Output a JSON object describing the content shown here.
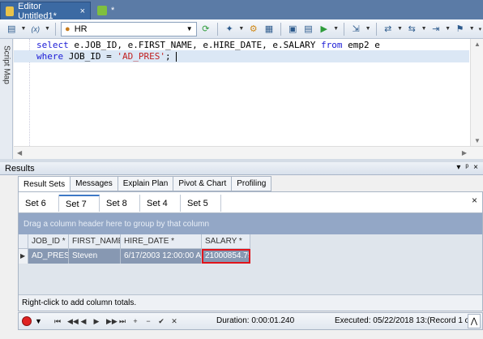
{
  "tabs": [
    {
      "label": "Editor Untitled1*",
      "close": "×"
    },
    {
      "label": "*"
    }
  ],
  "toolbar": {
    "connection": "HR"
  },
  "script_map": {
    "label": "Script Map"
  },
  "editor": {
    "line1": {
      "k1": "select",
      "t1": " e.JOB_ID, e.FIRST_NAME, e.HIRE_DATE, e.SALARY ",
      "k2": "from",
      "t2": " emp2 e"
    },
    "line2": {
      "k1": "where",
      "t1": " JOB_ID = ",
      "s1": "'AD_PRES'",
      "t2": ";"
    }
  },
  "results": {
    "title": "Results",
    "controls": [
      "▾",
      "ᵖ",
      "×"
    ],
    "tabs": [
      "Result Sets",
      "Messages",
      "Explain Plan",
      "Pivot & Chart",
      "Profiling"
    ],
    "set_tabs": [
      "Set 6",
      "Set 7",
      "Set 8",
      "Set 4",
      "Set 5"
    ],
    "close": "×",
    "group_hint": "Drag a column header here to group by that column",
    "columns": [
      "JOB_ID",
      "FIRST_NAME",
      "HIRE_DATE",
      "SALARY"
    ],
    "rows": [
      [
        "AD_PRES",
        "Steven",
        "6/17/2003 12:00:00 AM",
        "21000854.75"
      ]
    ],
    "footer": "Right-click to add column totals."
  },
  "status": {
    "duration": "Duration: 0:00:01.240",
    "executed": "Executed: 05/22/2018 13:(Record 1 of 1"
  }
}
